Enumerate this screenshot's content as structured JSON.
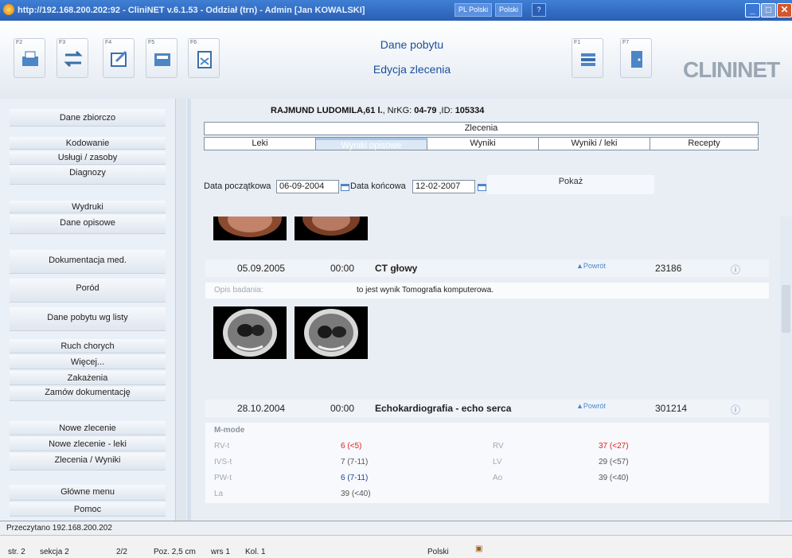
{
  "titlebar": {
    "url": "http://192.168.200.202:92",
    "app": "CliniNET v.6.1.53",
    "ward": "Oddział (trn)",
    "user": "Admin [Jan KOWALSKI]",
    "lang1": "PL Polski",
    "lang2": "Polski",
    "help": "?",
    "close": "✕"
  },
  "toolbar": {
    "fkeys": [
      "F2",
      "F3",
      "F4",
      "F5",
      "F6",
      "F1",
      "F7"
    ],
    "title": "Dane pobytu",
    "subtitle": "Edycja zlecenia",
    "logo": "CLININET"
  },
  "sidebar": {
    "items": [
      "Dane zbiorczo",
      "Kodowanie",
      "Usługi / zasoby",
      "Diagnozy",
      "Wydruki",
      "Dane opisowe",
      "Dokumentacja med.",
      "Poród",
      "Dane pobytu wg listy",
      "Ruch chorych",
      "Więcej...",
      "Zakażenia",
      "Zamów dokumentację",
      "Nowe zlecenie",
      "Nowe zlecenie - leki",
      "Zlecenia / Wyniki",
      "Główne menu",
      "Pomoc"
    ]
  },
  "patient": {
    "name": "RAJMUND LUDOMILA,61 l.",
    "nrkg_label": ", NrKG:",
    "nrkg": "04-79",
    "id_label": ",ID:",
    "id": "105334"
  },
  "tabs": {
    "top": "Zlecenia",
    "items": [
      "Leki",
      "Wyniki opisowe",
      "Wyniki",
      "Wyniki / leki",
      "Recepty"
    ]
  },
  "filter": {
    "start_label": "Data początkowa",
    "start": "06-09-2004",
    "end_label": "Data końcowa",
    "end": "12-02-2007",
    "show": "Pokaż"
  },
  "results": [
    {
      "date": "05.09.2005",
      "time": "00:00",
      "name": "CT głowy",
      "back": "Powrót",
      "num": "23186",
      "desc_label": "Opis badania:",
      "desc": "to jest wynik Tomografia komputerowa."
    },
    {
      "date": "28.10.2004",
      "time": "00:00",
      "name": "Echokardiografia - echo serca",
      "back": "Powrót",
      "num": "301214"
    }
  ],
  "mmode": {
    "title": "M-mode",
    "rows": [
      {
        "l1": "RV-t",
        "v1": "6 (<5)",
        "l2": "RV",
        "v2": "37 (<27)"
      },
      {
        "l1": "IVS-t",
        "v1": "7 (7-11)",
        "l2": "LV",
        "v2": "29 (<57)"
      },
      {
        "l1": "PW-t",
        "v1": "6 (7-11)",
        "l2": "Ao",
        "v2": "39 (<40)"
      },
      {
        "l1": "La",
        "v1": "39 (<40)"
      }
    ]
  },
  "status": "Przeczytano 192.168.200.202",
  "wordbar": {
    "str": "str. 2",
    "sekcja": "sekcja 2",
    "pages": "2/2",
    "poz": "Poz. 2,5 cm",
    "wrs": "wrs 1",
    "kol": "Kol. 1",
    "lang": "Polski"
  },
  "colors": {
    "accent": "#1a4f9a",
    "red": "#e02020",
    "blue": "#1f3f9a"
  }
}
